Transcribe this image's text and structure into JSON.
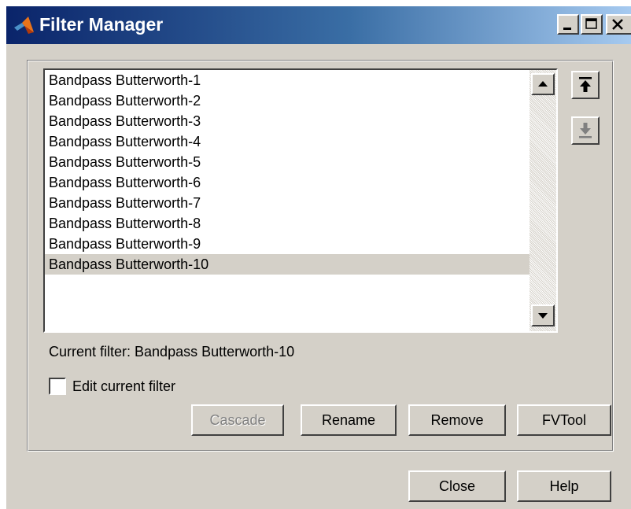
{
  "window": {
    "title": "Filter Manager",
    "minimize_label": "_",
    "maximize_label": "□",
    "close_label": "×"
  },
  "filters": {
    "items": [
      "Bandpass Butterworth-1",
      "Bandpass Butterworth-2",
      "Bandpass Butterworth-3",
      "Bandpass Butterworth-4",
      "Bandpass Butterworth-5",
      "Bandpass Butterworth-6",
      "Bandpass Butterworth-7",
      "Bandpass Butterworth-8",
      "Bandpass Butterworth-9",
      "Bandpass Butterworth-10"
    ],
    "selected_index": 9
  },
  "current_filter": {
    "text": "Current filter: Bandpass Butterworth-10"
  },
  "edit_checkbox": {
    "label": "Edit current filter",
    "checked": false
  },
  "buttons": {
    "cascade": "Cascade",
    "rename": "Rename",
    "remove": "Remove",
    "fvtool": "FVTool",
    "close": "Close",
    "help": "Help"
  },
  "icons": {
    "app": "matlab-logo-icon",
    "move_up": "move-up-arrow-icon",
    "move_down": "move-down-arrow-icon",
    "scroll_up": "scroll-up-triangle-icon",
    "scroll_down": "scroll-down-triangle-icon"
  },
  "colors": {
    "title_gradient_start": "#0a246a",
    "title_gradient_end": "#a6caf0",
    "face": "#d4d0c8",
    "selection": "#d4d0c8",
    "disabled_text": "#808080"
  }
}
